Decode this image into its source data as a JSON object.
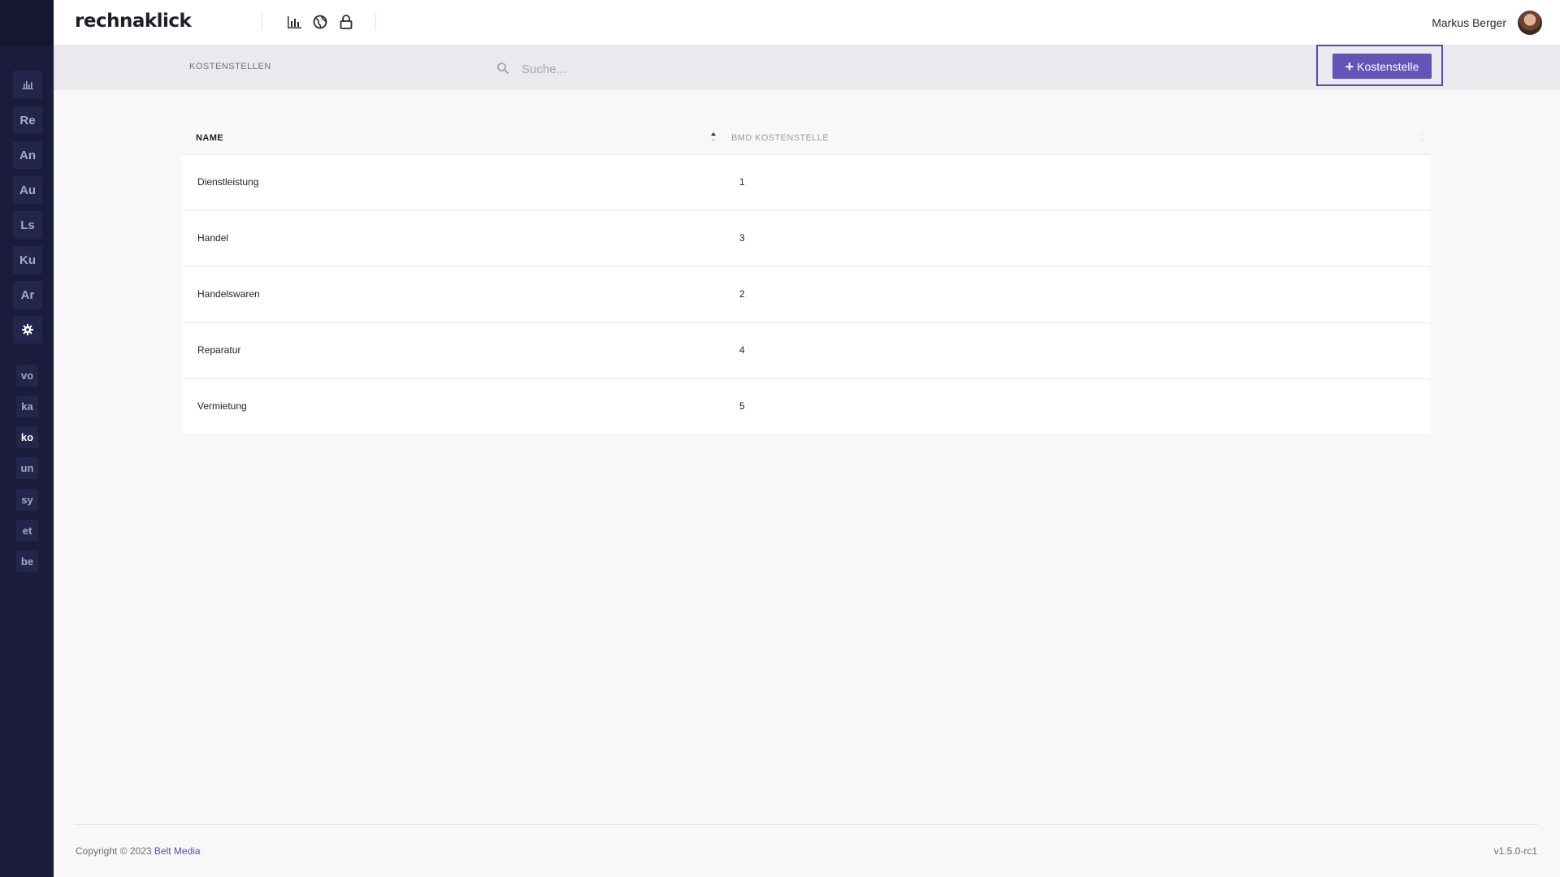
{
  "app": {
    "logo": "rechnaklick"
  },
  "header": {
    "icons": [
      "bar-chart-icon",
      "globe-icon",
      "lock-icon"
    ],
    "user_name": "Markus Berger"
  },
  "sidebar": {
    "main_items": [
      {
        "label": "",
        "icon": "bar-chart-icon"
      },
      {
        "label": "Re"
      },
      {
        "label": "An"
      },
      {
        "label": "Au"
      },
      {
        "label": "Ls"
      },
      {
        "label": "Ku"
      },
      {
        "label": "Ar"
      },
      {
        "label": "",
        "icon": "gear-icon"
      }
    ],
    "sub_items": [
      {
        "label": "vo"
      },
      {
        "label": "ka"
      },
      {
        "label": "ko",
        "active": true
      },
      {
        "label": "un"
      },
      {
        "label": "sy"
      },
      {
        "label": "et"
      },
      {
        "label": "be"
      }
    ]
  },
  "toolbar": {
    "title": "KOSTENSTELLEN",
    "search_placeholder": "Suche...",
    "add_button_label": "Kostenstelle"
  },
  "table": {
    "columns": [
      "NAME",
      "BMD KOSTENSTELLE"
    ],
    "rows": [
      {
        "name": "Dienstleistung",
        "bmd": "1"
      },
      {
        "name": "Handel",
        "bmd": "3"
      },
      {
        "name": "Handelswaren",
        "bmd": "2"
      },
      {
        "name": "Reparatur",
        "bmd": "4"
      },
      {
        "name": "Vermietung",
        "bmd": "5"
      }
    ]
  },
  "footer": {
    "copyright_prefix": "Copyright © 2023",
    "company": "Belt Media",
    "version": "v1.5.0-rc1"
  },
  "colors": {
    "sidebar_bg": "#1b1c3b",
    "accent": "#6454b7",
    "highlight_frame": "#5b4ab8"
  }
}
